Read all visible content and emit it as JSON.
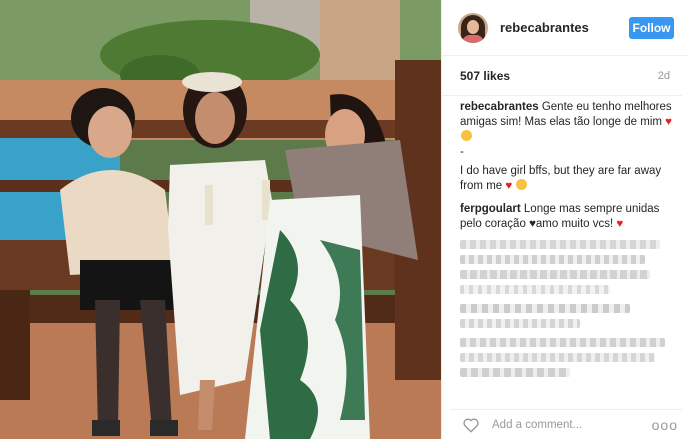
{
  "header": {
    "username": "rebecabrantes",
    "follow_label": "Follow"
  },
  "meta": {
    "likes": "507 likes",
    "time": "2d"
  },
  "caption": {
    "user": "rebecabrantes",
    "text": "Gente eu tenho melhores amigas sim! Mas elas tão longe de mim",
    "dash": "-",
    "translation": "I do have girl bffs, but they are far away from me"
  },
  "comments": [
    {
      "user": "ferpgoulart",
      "text_a": "Longe mas sempre unidas pelo coração",
      "text_b": "amo muito vcs!"
    }
  ],
  "footer": {
    "placeholder": "Add a comment...",
    "more": "ooo"
  },
  "colors": {
    "accent": "#3897f0",
    "heart": "#ed1d24",
    "muted": "#999999"
  }
}
